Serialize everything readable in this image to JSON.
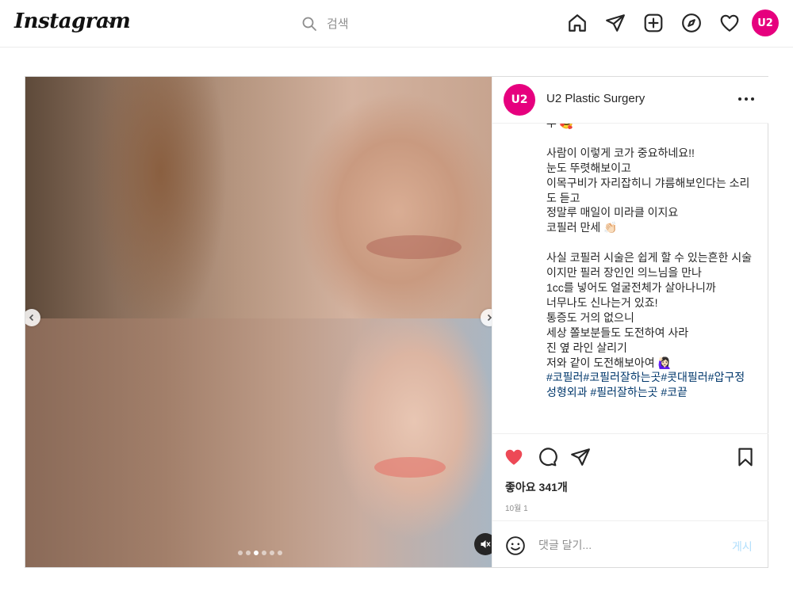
{
  "nav": {
    "logo": "Instagram",
    "search_placeholder": "검색",
    "icons": [
      "home-icon",
      "direct-icon",
      "new-post-icon",
      "explore-icon",
      "activity-heart-icon"
    ],
    "profile_initials": "U2"
  },
  "post": {
    "carousel": {
      "slides": 6,
      "active_index": 2
    },
    "author": {
      "username": "U2 Plastic Surgery",
      "avatar_initials": "U2"
    },
    "caption": "루 🥰\n\n사람이 이렇게 코가 중요하네요!!\n눈도 뚜렷해보이고\n이목구비가 자리잡히니 갸름해보인다는 소리도 듣고\n정말루 매일이 미라클 이지요\n코필러 만세 👏🏻\n\n사실 코필러 시술은 쉽게 할 수 있는흔한 시술이지만 필러 장인인 의느님을 만나\n1cc를 넣어도 얼굴전체가 살아나니까\n너무나도 신나는거 있죠!\n통증도 거의 없으니\n세상 쫄보분들도 도전하여 사라\n진 옆 라인 살리기\n저와 같이 도전해보아여 🙋🏻‍♀️\n",
    "hashtags": "#코필러#코필러잘하는곳#콧대필러#압구정성형외과 #필러잘하는곳 #코끝",
    "likes": "좋아요 341개",
    "date": "10월 1",
    "comment_placeholder": "댓글 달기...",
    "post_label": "게시",
    "colors": {
      "like": "#ed4956",
      "brand": "#e6007e",
      "link": "#00376b",
      "post_disabled": "#b2dffc"
    }
  }
}
